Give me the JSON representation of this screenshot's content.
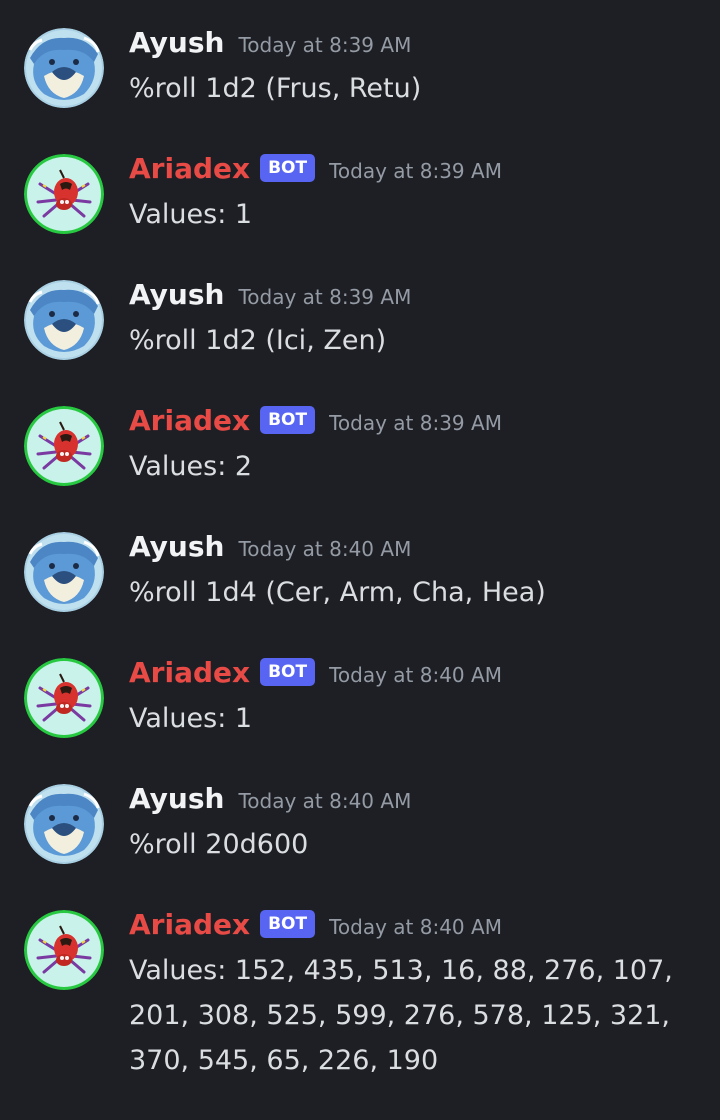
{
  "colors": {
    "background": "#1e1f25",
    "text": "#dbdee1",
    "timestamp": "#949ba4",
    "bot_badge": "#5865f2",
    "user_name": "#f2f3f5",
    "bot_name": "#e84a45"
  },
  "messages": [
    {
      "author": "Ayush",
      "bot": false,
      "badge": "",
      "timestamp": "Today at 8:39 AM",
      "text": "%roll 1d2 (Frus, Retu)",
      "avatar_icon": "whale-pokemon-avatar-icon"
    },
    {
      "author": "Ariadex",
      "bot": true,
      "badge": "BOT",
      "timestamp": "Today at 8:39 AM",
      "text": "Values: 1",
      "avatar_icon": "spider-pokemon-avatar-icon"
    },
    {
      "author": "Ayush",
      "bot": false,
      "badge": "",
      "timestamp": "Today at 8:39 AM",
      "text": "%roll 1d2 (Ici, Zen)",
      "avatar_icon": "whale-pokemon-avatar-icon"
    },
    {
      "author": "Ariadex",
      "bot": true,
      "badge": "BOT",
      "timestamp": "Today at 8:39 AM",
      "text": "Values: 2",
      "avatar_icon": "spider-pokemon-avatar-icon"
    },
    {
      "author": "Ayush",
      "bot": false,
      "badge": "",
      "timestamp": "Today at 8:40 AM",
      "text": "%roll 1d4 (Cer, Arm, Cha, Hea)",
      "avatar_icon": "whale-pokemon-avatar-icon"
    },
    {
      "author": "Ariadex",
      "bot": true,
      "badge": "BOT",
      "timestamp": "Today at 8:40 AM",
      "text": "Values: 1",
      "avatar_icon": "spider-pokemon-avatar-icon"
    },
    {
      "author": "Ayush",
      "bot": false,
      "badge": "",
      "timestamp": "Today at 8:40 AM",
      "text": "%roll 20d600",
      "avatar_icon": "whale-pokemon-avatar-icon"
    },
    {
      "author": "Ariadex",
      "bot": true,
      "badge": "BOT",
      "timestamp": "Today at 8:40 AM",
      "text": "Values: 152, 435, 513, 16, 88, 276, 107, 201, 308, 525, 599, 276, 578, 125, 321, 370, 545, 65, 226, 190",
      "avatar_icon": "spider-pokemon-avatar-icon"
    }
  ]
}
